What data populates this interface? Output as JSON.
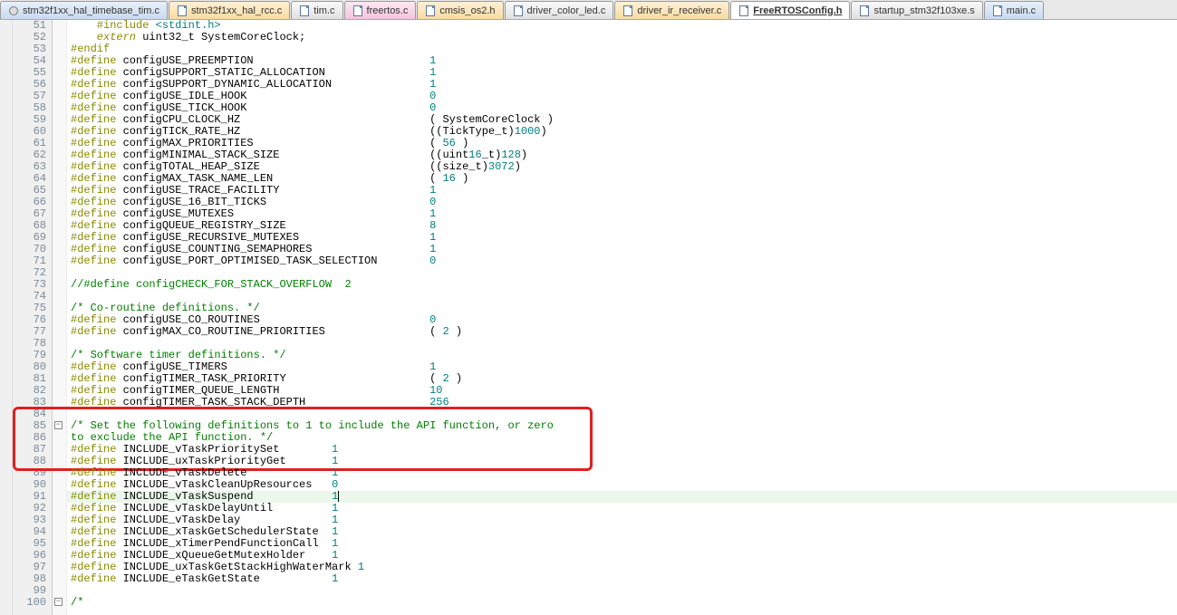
{
  "tabs": [
    {
      "label": "stm32f1xx_hal_timebase_tim.c",
      "accent": "a3",
      "icon": "gear-icon"
    },
    {
      "label": "stm32f1xx_hal_rcc.c",
      "accent": "a1",
      "icon": "file-icon"
    },
    {
      "label": "tim.c",
      "accent": "",
      "icon": "file-icon"
    },
    {
      "label": "freertos.c",
      "accent": "a2",
      "icon": "file-icon"
    },
    {
      "label": "cmsis_os2.h",
      "accent": "a1",
      "icon": "file-icon"
    },
    {
      "label": "driver_color_led.c",
      "accent": "",
      "icon": "file-icon"
    },
    {
      "label": "driver_ir_receiver.c",
      "accent": "a1",
      "icon": "file-icon"
    },
    {
      "label": "FreeRTOSConfig.h",
      "accent": "active",
      "icon": "file-icon"
    },
    {
      "label": "startup_stm32f103xe.s",
      "accent": "",
      "icon": "file-icon"
    },
    {
      "label": "main.c",
      "accent": "a3",
      "icon": "file-icon"
    }
  ],
  "fold_marks": [
    {
      "line": 85,
      "glyph": "-"
    },
    {
      "line": 100,
      "glyph": "-"
    }
  ],
  "highlight_box": {
    "from_line": 84,
    "to_line": 88
  },
  "cursor_line": 91,
  "code_lines": [
    {
      "n": 51,
      "t": "cpp",
      "txt": "    #include <stdint.h>"
    },
    {
      "n": 52,
      "t": "cpp",
      "txt": "    extern uint32_t SystemCoreClock;"
    },
    {
      "n": 53,
      "t": "dir",
      "txt": "#endif"
    },
    {
      "n": 54,
      "t": "def",
      "name": "configUSE_PREEMPTION",
      "val": "1"
    },
    {
      "n": 55,
      "t": "def",
      "name": "configSUPPORT_STATIC_ALLOCATION",
      "val": "1"
    },
    {
      "n": 56,
      "t": "def",
      "name": "configSUPPORT_DYNAMIC_ALLOCATION",
      "val": "1"
    },
    {
      "n": 57,
      "t": "def",
      "name": "configUSE_IDLE_HOOK",
      "val": "0"
    },
    {
      "n": 58,
      "t": "def",
      "name": "configUSE_TICK_HOOK",
      "val": "0"
    },
    {
      "n": 59,
      "t": "def",
      "name": "configCPU_CLOCK_HZ",
      "val": "( SystemCoreClock )"
    },
    {
      "n": 60,
      "t": "def",
      "name": "configTICK_RATE_HZ",
      "val": "((TickType_t)1000)"
    },
    {
      "n": 61,
      "t": "def",
      "name": "configMAX_PRIORITIES",
      "val": "( 56 )"
    },
    {
      "n": 62,
      "t": "def",
      "name": "configMINIMAL_STACK_SIZE",
      "val": "((uint16_t)128)"
    },
    {
      "n": 63,
      "t": "def",
      "name": "configTOTAL_HEAP_SIZE",
      "val": "((size_t)3072)"
    },
    {
      "n": 64,
      "t": "def",
      "name": "configMAX_TASK_NAME_LEN",
      "val": "( 16 )"
    },
    {
      "n": 65,
      "t": "def",
      "name": "configUSE_TRACE_FACILITY",
      "val": "1"
    },
    {
      "n": 66,
      "t": "def",
      "name": "configUSE_16_BIT_TICKS",
      "val": "0"
    },
    {
      "n": 67,
      "t": "def",
      "name": "configUSE_MUTEXES",
      "val": "1"
    },
    {
      "n": 68,
      "t": "def",
      "name": "configQUEUE_REGISTRY_SIZE",
      "val": "8"
    },
    {
      "n": 69,
      "t": "def",
      "name": "configUSE_RECURSIVE_MUTEXES",
      "val": "1"
    },
    {
      "n": 70,
      "t": "def",
      "name": "configUSE_COUNTING_SEMAPHORES",
      "val": "1"
    },
    {
      "n": 71,
      "t": "def",
      "name": "configUSE_PORT_OPTIMISED_TASK_SELECTION",
      "val": "0"
    },
    {
      "n": 72,
      "t": "blank"
    },
    {
      "n": 73,
      "t": "cm",
      "txt": "//#define configCHECK_FOR_STACK_OVERFLOW  2"
    },
    {
      "n": 74,
      "t": "blank"
    },
    {
      "n": 75,
      "t": "cm",
      "txt": "/* Co-routine definitions. */"
    },
    {
      "n": 76,
      "t": "def",
      "name": "configUSE_CO_ROUTINES",
      "val": "0"
    },
    {
      "n": 77,
      "t": "def",
      "name": "configMAX_CO_ROUTINE_PRIORITIES",
      "val": "( 2 )"
    },
    {
      "n": 78,
      "t": "blank"
    },
    {
      "n": 79,
      "t": "cm",
      "txt": "/* Software timer definitions. */"
    },
    {
      "n": 80,
      "t": "def",
      "name": "configUSE_TIMERS",
      "val": "1"
    },
    {
      "n": 81,
      "t": "def",
      "name": "configTIMER_TASK_PRIORITY",
      "val": "( 2 )"
    },
    {
      "n": 82,
      "t": "def",
      "name": "configTIMER_QUEUE_LENGTH",
      "val": "10"
    },
    {
      "n": 83,
      "t": "def",
      "name": "configTIMER_TASK_STACK_DEPTH",
      "val": "256"
    },
    {
      "n": 84,
      "t": "blank"
    },
    {
      "n": 85,
      "t": "cm",
      "txt": "/* Set the following definitions to 1 to include the API function, or zero"
    },
    {
      "n": 86,
      "t": "cm",
      "txt": "to exclude the API function. */"
    },
    {
      "n": 87,
      "t": "def",
      "name": "INCLUDE_vTaskPrioritySet",
      "val": "1",
      "col2": 40
    },
    {
      "n": 88,
      "t": "def",
      "name": "INCLUDE_uxTaskPriorityGet",
      "val": "1",
      "col2": 40
    },
    {
      "n": 89,
      "t": "def",
      "name": "INCLUDE_vTaskDelete",
      "val": "1",
      "col2": 40
    },
    {
      "n": 90,
      "t": "def",
      "name": "INCLUDE_vTaskCleanUpResources",
      "val": "0",
      "col2": 40
    },
    {
      "n": 91,
      "t": "def",
      "name": "INCLUDE_vTaskSuspend",
      "val": "1",
      "col2": 40,
      "cursor": true,
      "hi": true
    },
    {
      "n": 92,
      "t": "def",
      "name": "INCLUDE_vTaskDelayUntil",
      "val": "1",
      "col2": 40
    },
    {
      "n": 93,
      "t": "def",
      "name": "INCLUDE_vTaskDelay",
      "val": "1",
      "col2": 40
    },
    {
      "n": 94,
      "t": "def",
      "name": "INCLUDE_xTaskGetSchedulerState",
      "val": "1",
      "col2": 40
    },
    {
      "n": 95,
      "t": "def",
      "name": "INCLUDE_xTimerPendFunctionCall",
      "val": "1",
      "col2": 40
    },
    {
      "n": 96,
      "t": "def",
      "name": "INCLUDE_xQueueGetMutexHolder",
      "val": "1",
      "col2": 40
    },
    {
      "n": 97,
      "t": "def",
      "name": "INCLUDE_uxTaskGetStackHighWaterMark",
      "val": "1",
      "col2": 40
    },
    {
      "n": 98,
      "t": "def",
      "name": "INCLUDE_eTaskGetState",
      "val": "1",
      "col2": 40
    },
    {
      "n": 99,
      "t": "blank"
    },
    {
      "n": 100,
      "t": "cm",
      "txt": "/*"
    }
  ],
  "define_value_column": 55
}
